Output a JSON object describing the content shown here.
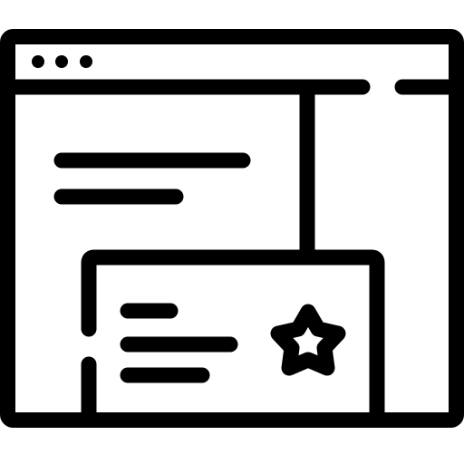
{
  "icon": {
    "name": "browser-window-featured-card-icon",
    "stroke_color": "#000000",
    "background_color": "#ffffff"
  }
}
